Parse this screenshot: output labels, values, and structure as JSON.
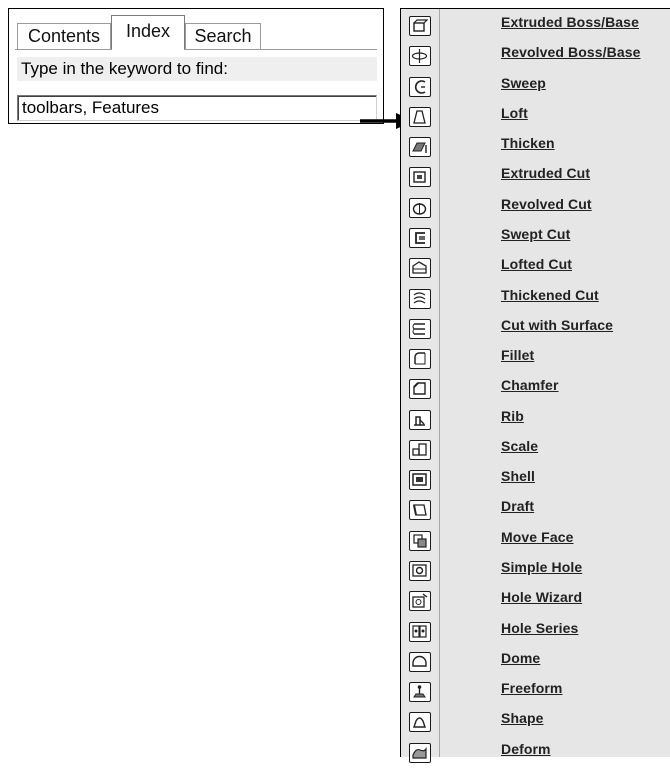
{
  "help_panel": {
    "tabs": [
      "Contents",
      "Index",
      "Search"
    ],
    "prompt": "Type in the keyword to find:",
    "keyword_value": "toolbars, Features"
  },
  "features": [
    {
      "label": "Extruded Boss/Base",
      "icon": "extruded-boss-icon"
    },
    {
      "label": "Revolved Boss/Base",
      "icon": "revolved-boss-icon"
    },
    {
      "label": "Sweep",
      "icon": "sweep-icon"
    },
    {
      "label": "Loft",
      "icon": "loft-icon"
    },
    {
      "label": "Thicken",
      "icon": "thicken-icon"
    },
    {
      "label": "Extruded Cut",
      "icon": "extruded-cut-icon"
    },
    {
      "label": "Revolved Cut",
      "icon": "revolved-cut-icon"
    },
    {
      "label": "Swept Cut",
      "icon": "swept-cut-icon"
    },
    {
      "label": "Lofted Cut",
      "icon": "lofted-cut-icon"
    },
    {
      "label": "Thickened Cut",
      "icon": "thickened-cut-icon"
    },
    {
      "label": "Cut with Surface",
      "icon": "cut-with-surface-icon"
    },
    {
      "label": "Fillet",
      "icon": "fillet-icon"
    },
    {
      "label": "Chamfer",
      "icon": "chamfer-icon"
    },
    {
      "label": "Rib",
      "icon": "rib-icon"
    },
    {
      "label": "Scale",
      "icon": "scale-icon"
    },
    {
      "label": "Shell",
      "icon": "shell-icon"
    },
    {
      "label": "Draft",
      "icon": "draft-icon"
    },
    {
      "label": "Move Face",
      "icon": "move-face-icon"
    },
    {
      "label": "Simple Hole",
      "icon": "simple-hole-icon"
    },
    {
      "label": "Hole Wizard",
      "icon": "hole-wizard-icon"
    },
    {
      "label": "Hole Series",
      "icon": "hole-series-icon"
    },
    {
      "label": "Dome",
      "icon": "dome-icon"
    },
    {
      "label": "Freeform",
      "icon": "freeform-icon"
    },
    {
      "label": "Shape",
      "icon": "shape-icon"
    },
    {
      "label": "Deform",
      "icon": "deform-icon"
    }
  ]
}
